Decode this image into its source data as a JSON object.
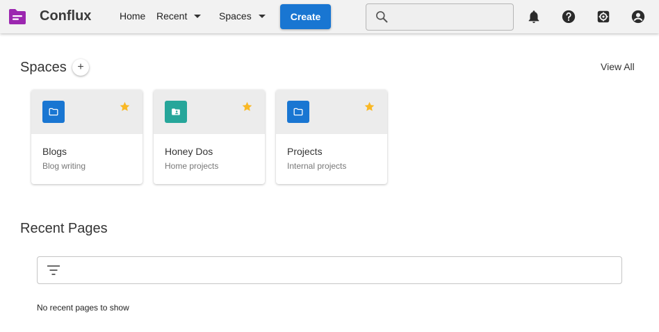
{
  "header": {
    "app_title": "Conflux",
    "nav": {
      "home": "Home",
      "recent": "Recent",
      "spaces": "Spaces"
    },
    "create_label": "Create",
    "search": {
      "placeholder": "",
      "value": ""
    },
    "icons": [
      "bell-icon",
      "help-icon",
      "settings-icon",
      "account-icon"
    ]
  },
  "spaces": {
    "title": "Spaces",
    "add_label": "+",
    "view_all": "View All",
    "items": [
      {
        "name": "Blogs",
        "description": "Blog writing",
        "icon": "folder-icon",
        "color": "#1976d2",
        "starred": true
      },
      {
        "name": "Honey Dos",
        "description": "Home projects",
        "icon": "folder-shared-icon",
        "color": "#26a69a",
        "starred": true
      },
      {
        "name": "Projects",
        "description": "Internal projects",
        "icon": "folder-icon",
        "color": "#1976d2",
        "starred": true
      }
    ]
  },
  "recent_pages": {
    "title": "Recent Pages",
    "filter": {
      "placeholder": "",
      "value": ""
    },
    "empty_message": "No recent pages to show"
  },
  "colors": {
    "primary": "#1976d2",
    "teal": "#26a69a",
    "star": "#f9b825",
    "logo": "#9c27b0"
  }
}
